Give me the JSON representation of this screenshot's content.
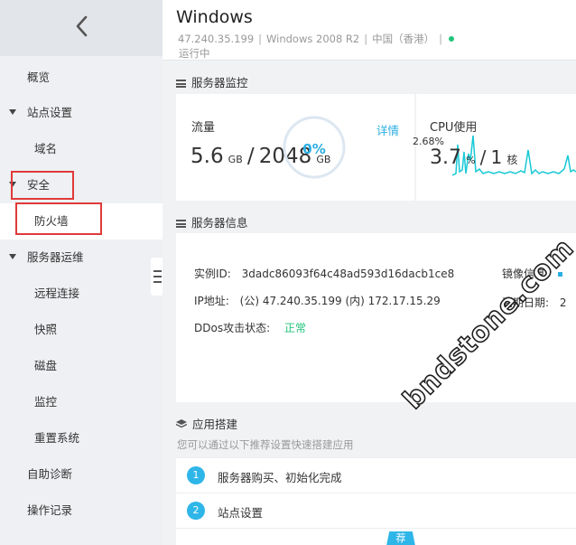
{
  "sidebar": {
    "items": [
      {
        "label": "概览",
        "level": 0
      },
      {
        "label": "站点设置",
        "level": 0,
        "expandable": true
      },
      {
        "label": "域名",
        "level": 1
      },
      {
        "label": "安全",
        "level": 0,
        "expandable": true
      },
      {
        "label": "防火墙",
        "level": 1,
        "selected": true
      },
      {
        "label": "服务器运维",
        "level": 0,
        "expandable": true
      },
      {
        "label": "远程连接",
        "level": 1
      },
      {
        "label": "快照",
        "level": 1
      },
      {
        "label": "磁盘",
        "level": 1
      },
      {
        "label": "监控",
        "level": 1
      },
      {
        "label": "重置系统",
        "level": 1
      },
      {
        "label": "自助诊断",
        "level": 0
      },
      {
        "label": "操作记录",
        "level": 0
      }
    ]
  },
  "header": {
    "title": "Windows",
    "ip": "47.240.35.199",
    "os": "Windows 2008 R2",
    "region": "中国（香港）",
    "sep": "|",
    "status": "运行中",
    "status_color": "#22c37a"
  },
  "monitor": {
    "title": "服务器监控",
    "traffic_label": "流量",
    "traffic_used": "5.6",
    "traffic_used_unit": "GB",
    "traffic_slash": "/",
    "traffic_total": "2048",
    "traffic_total_unit": "GB",
    "traffic_percent": "0%",
    "traffic_fraction": 0,
    "detail_link": "详情",
    "cpu_label": "CPU使用",
    "cpu_peak": "2.68%",
    "cpu_usage": "3.7",
    "cpu_usage_unit": "%",
    "cpu_slash": "/",
    "cpu_cores": "1",
    "cpu_cores_unit": "核"
  },
  "info": {
    "title": "服务器信息",
    "instance_id_label": "实例ID:",
    "instance_id": "3dadc86093f64c48ad593d16dacb1ce8",
    "ip_label": "IP地址:",
    "ip_value": "(公) 47.240.35.199 (内) 172.17.15.29",
    "ddos_label": "DDos攻击状态:",
    "ddos_value": "正常",
    "ddos_color": "#22c37a",
    "image_label": "镜像信息:",
    "expire_label": "到期日期:",
    "expire_value_partial": "2"
  },
  "app": {
    "title": "应用搭建",
    "subtitle": "您可以通过以下推荐设置快速搭建应用",
    "steps": [
      {
        "num": "1",
        "label": "服务器购买、初始化完成"
      },
      {
        "num": "2",
        "label": "站点设置"
      }
    ],
    "recommend_badge": "荐"
  },
  "colors": {
    "accent": "#2aaee3",
    "highlight_box": "#e03a3a",
    "sidebar_bg": "#eef0f3"
  },
  "icons": [
    "chevron-left-icon",
    "caret-down-icon",
    "server-icon",
    "layers-icon",
    "menu-icon"
  ],
  "watermark": "bndstone.com"
}
